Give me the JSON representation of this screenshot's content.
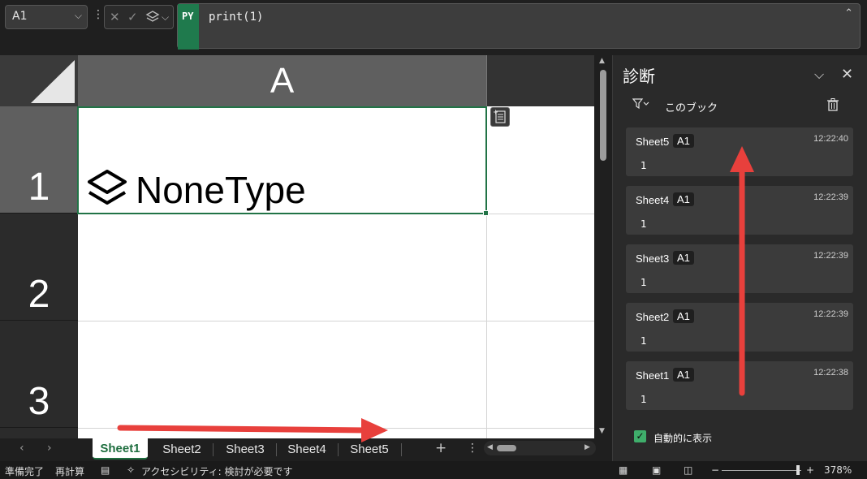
{
  "formula_bar": {
    "name_box": "A1",
    "language_badge": "PY",
    "formula": "print(1)"
  },
  "grid": {
    "column_headers": [
      "A"
    ],
    "row_headers": [
      "1",
      "2",
      "3"
    ],
    "cell_a1_value": "NoneType"
  },
  "sheet_tabs": [
    "Sheet1",
    "Sheet2",
    "Sheet3",
    "Sheet4",
    "Sheet5"
  ],
  "active_sheet": "Sheet1",
  "diagnostics_panel": {
    "title": "診断",
    "filter_label": "このブック",
    "entries": [
      {
        "sheet": "Sheet5",
        "cell": "A1",
        "time": "12:22:40",
        "value": "1"
      },
      {
        "sheet": "Sheet4",
        "cell": "A1",
        "time": "12:22:39",
        "value": "1"
      },
      {
        "sheet": "Sheet3",
        "cell": "A1",
        "time": "12:22:39",
        "value": "1"
      },
      {
        "sheet": "Sheet2",
        "cell": "A1",
        "time": "12:22:39",
        "value": "1"
      },
      {
        "sheet": "Sheet1",
        "cell": "A1",
        "time": "12:22:38",
        "value": "1"
      }
    ],
    "auto_show_label": "自動的に表示",
    "auto_show_checked": true
  },
  "status_bar": {
    "ready": "準備完了",
    "recalc": "再計算",
    "accessibility": "アクセシビリティ: 検討が必要です",
    "zoom": "378%"
  },
  "icons": {
    "accent_green": "#217346",
    "annotation_red": "#e8403c"
  }
}
